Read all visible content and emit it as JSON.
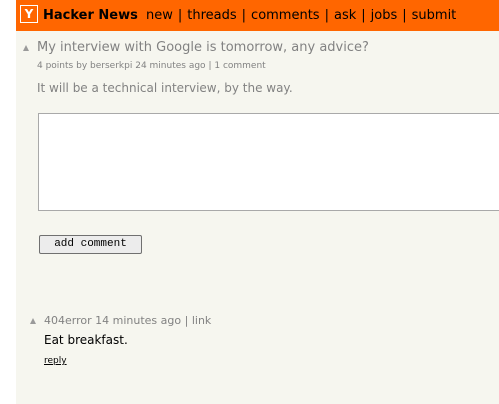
{
  "header": {
    "logo_letter": "Y",
    "site_title": "Hacker News",
    "nav": [
      {
        "label": "new"
      },
      {
        "label": "threads"
      },
      {
        "label": "comments"
      },
      {
        "label": "ask"
      },
      {
        "label": "jobs"
      },
      {
        "label": "submit"
      }
    ],
    "separator": "|",
    "bg_color": "#ff6600"
  },
  "story": {
    "title": "My interview with Google is tomorrow, any advice?",
    "points": "4 points",
    "by_label": "by",
    "author": "berserkpi",
    "age": "24 minutes ago",
    "separator": "|",
    "comments_link": "1 comment",
    "text": "It will be a technical interview, by the way."
  },
  "comment_form": {
    "value": "",
    "button_label": "add comment"
  },
  "comments": [
    {
      "author": "404error",
      "age": "14 minutes ago",
      "separator": "|",
      "link_label": "link",
      "text": "Eat breakfast.",
      "reply_label": "reply"
    }
  ],
  "icons": {
    "logo": "y-logo-icon",
    "upvote": "upvote-arrow-icon"
  },
  "colors": {
    "page_bg": "#f6f6ef",
    "subtext": "#828282"
  }
}
